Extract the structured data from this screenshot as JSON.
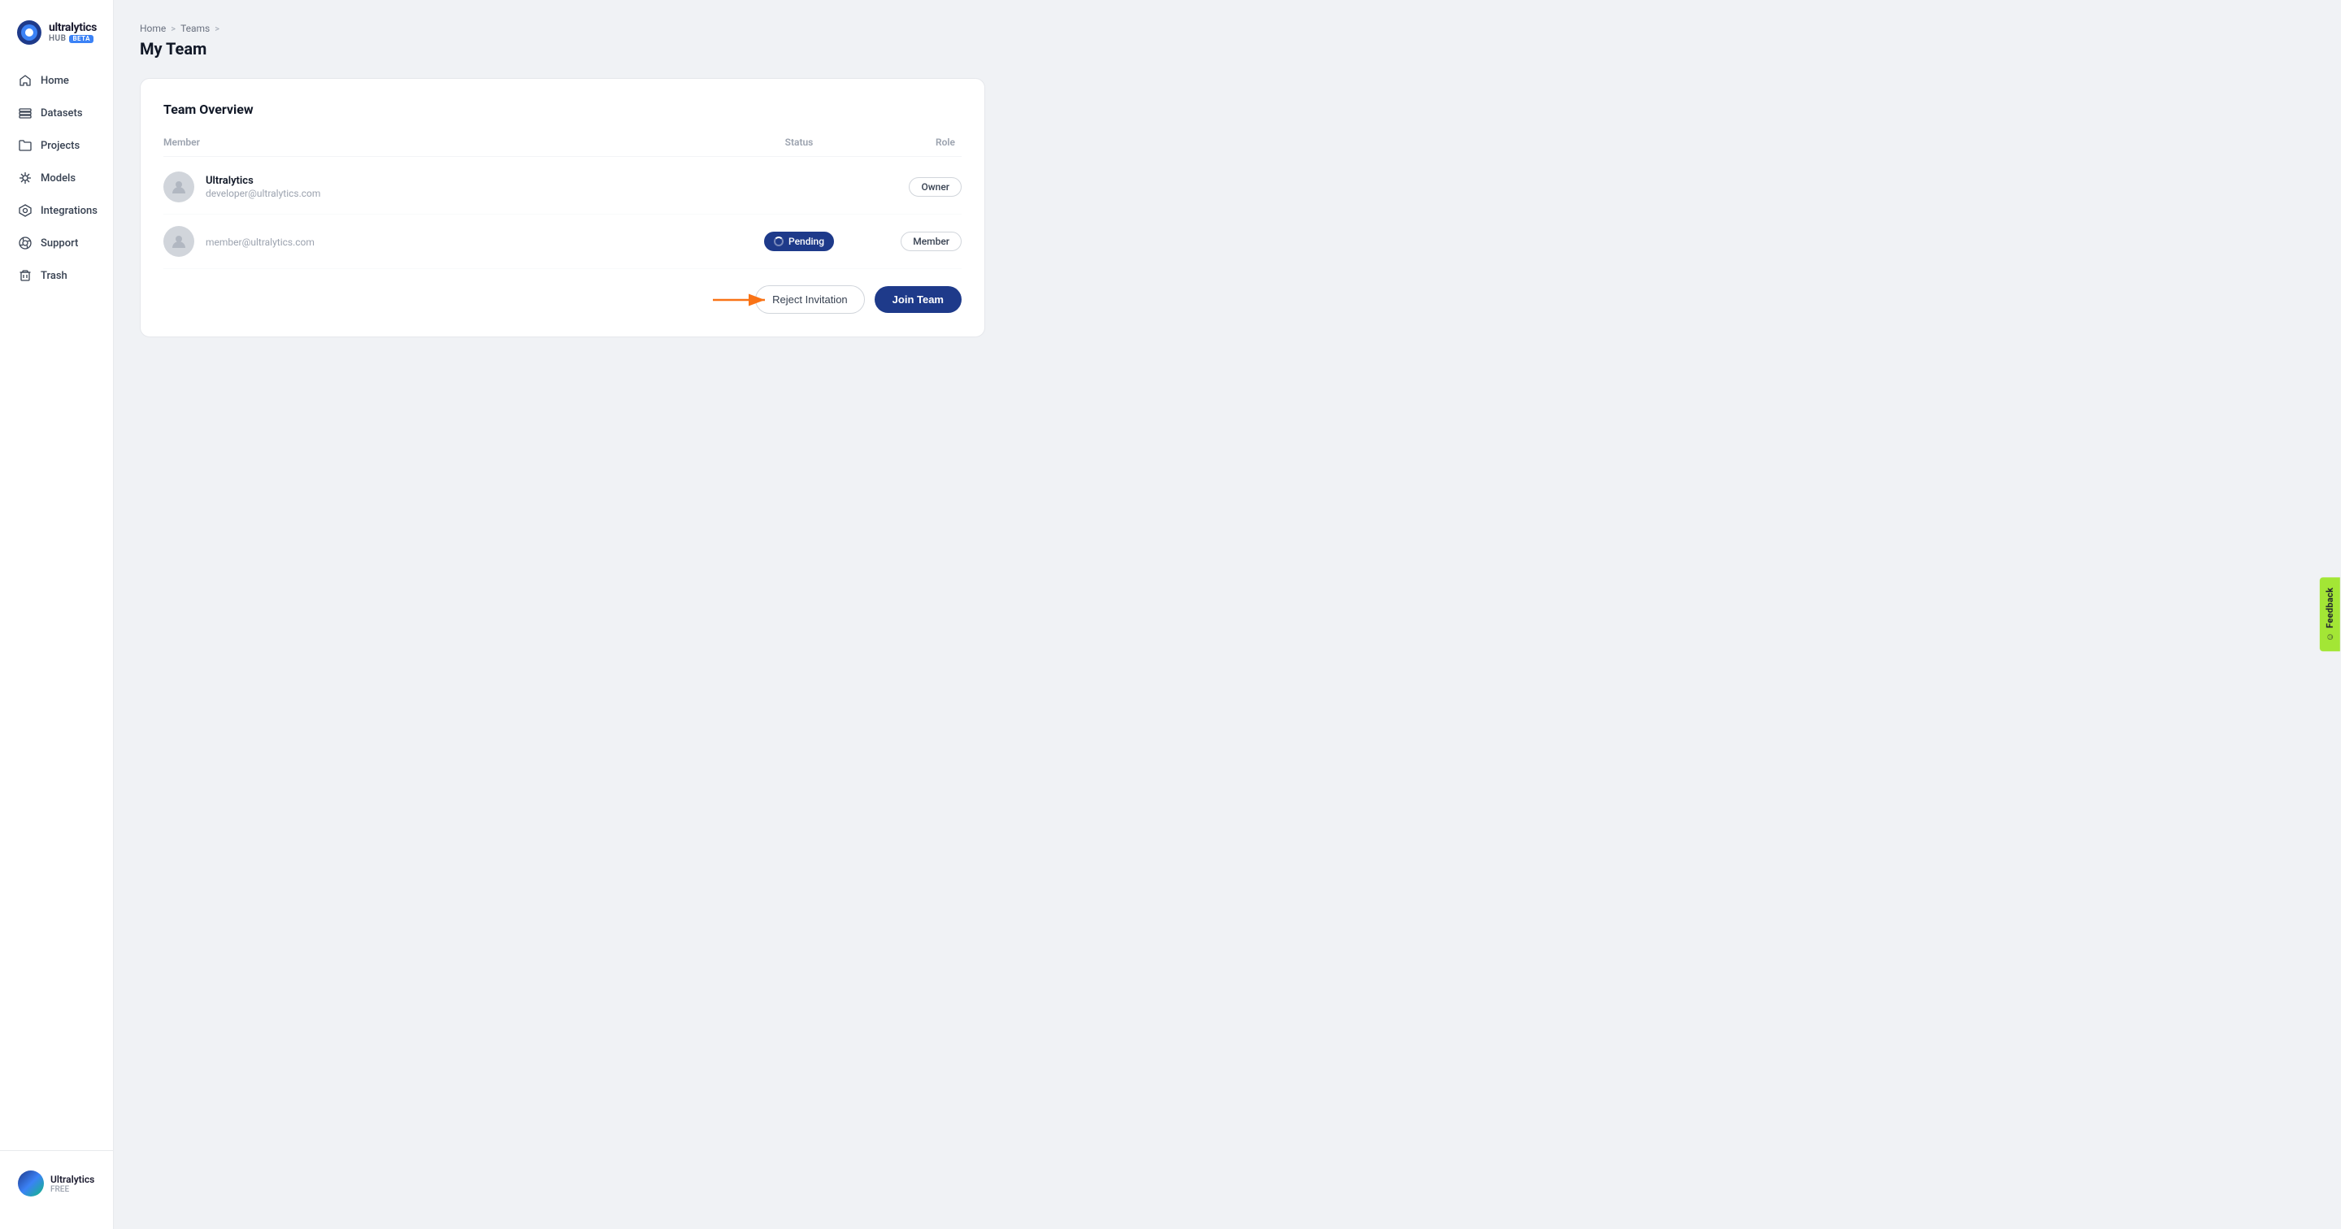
{
  "app": {
    "name": "ultralytics",
    "hub": "HUB",
    "beta": "BETA"
  },
  "sidebar": {
    "items": [
      {
        "id": "home",
        "label": "Home",
        "icon": "home"
      },
      {
        "id": "datasets",
        "label": "Datasets",
        "icon": "datasets"
      },
      {
        "id": "projects",
        "label": "Projects",
        "icon": "projects"
      },
      {
        "id": "models",
        "label": "Models",
        "icon": "models"
      },
      {
        "id": "integrations",
        "label": "Integrations",
        "icon": "integrations"
      },
      {
        "id": "support",
        "label": "Support",
        "icon": "support"
      },
      {
        "id": "trash",
        "label": "Trash",
        "icon": "trash"
      }
    ]
  },
  "user": {
    "name": "Ultralytics",
    "plan": "FREE"
  },
  "breadcrumb": {
    "home": "Home",
    "sep1": ">",
    "teams": "Teams",
    "sep2": ">",
    "current": ""
  },
  "page": {
    "title": "My Team"
  },
  "card": {
    "title": "Team Overview",
    "table": {
      "headers": {
        "member": "Member",
        "status": "Status",
        "role": "Role"
      },
      "rows": [
        {
          "name": "Ultralytics",
          "email": "developer@ultralytics.com",
          "status": "",
          "role": "Owner"
        },
        {
          "name": "",
          "email": "member@ultralytics.com",
          "status": "Pending",
          "role": "Member"
        }
      ]
    },
    "actions": {
      "reject": "Reject Invitation",
      "join": "Join Team"
    }
  },
  "feedback": {
    "label": "Feedback"
  }
}
